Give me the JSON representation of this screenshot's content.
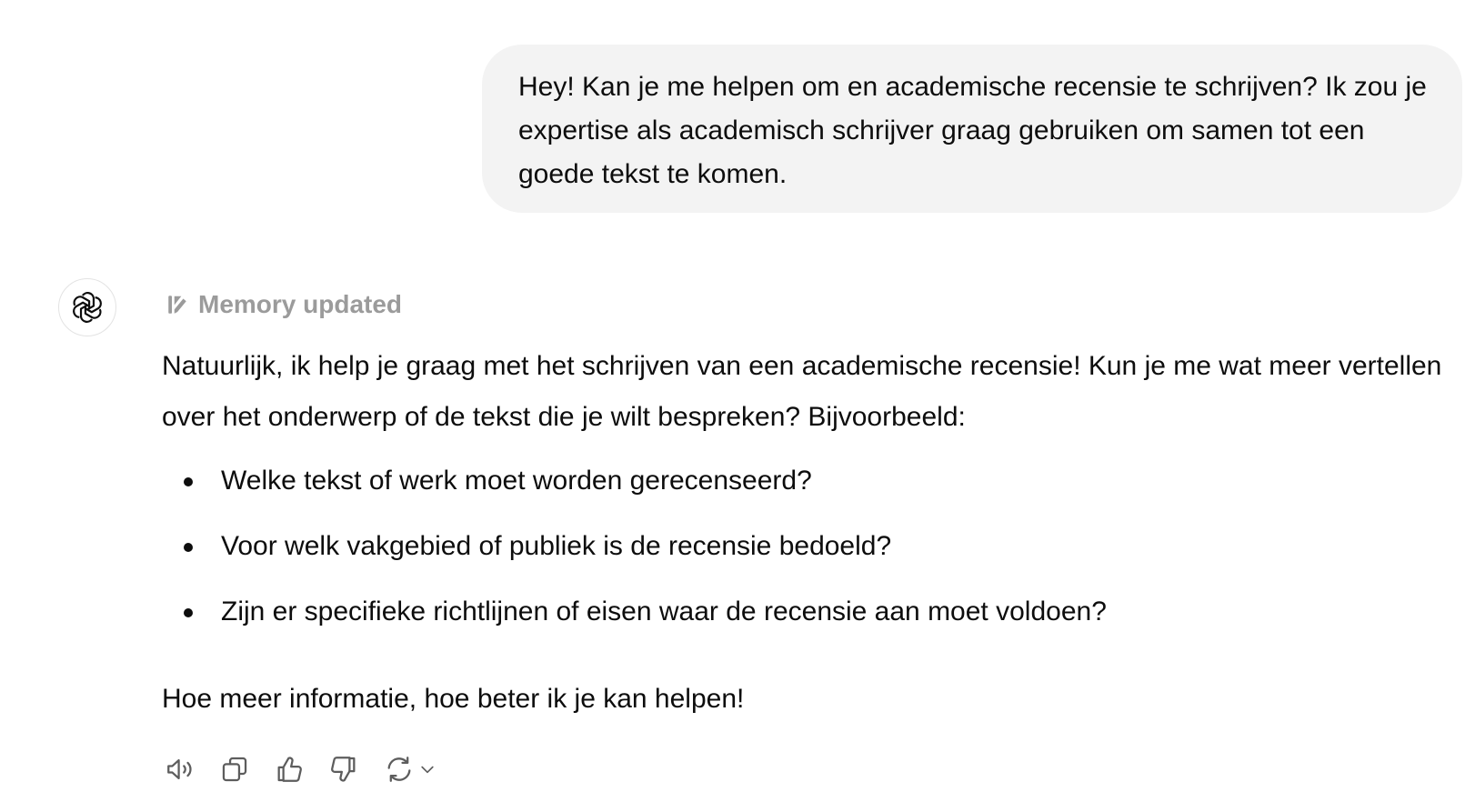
{
  "user_message": {
    "text": "Hey! Kan je me helpen om en academische recensie te schrijven? Ik zou je expertise als academisch schrijver graag gebruiken om samen tot een goede tekst te komen."
  },
  "assistant": {
    "avatar_icon": "openai-logo-icon",
    "memory_label": "Memory updated",
    "memory_icon": "memory-pencil-icon",
    "intro": "Natuurlijk, ik help je graag met het schrijven van een academische recensie! Kun je me wat meer vertellen over het onderwerp of de tekst die je wilt bespreken? Bijvoorbeeld:",
    "bullets": [
      "Welke tekst of werk moet worden gerecenseerd?",
      "Voor welk vakgebied of publiek is de recensie bedoeld?",
      "Zijn er specifieke richtlijnen of eisen waar de recensie aan moet voldoen?"
    ],
    "closing": "Hoe meer informatie, hoe beter ik je kan helpen!"
  },
  "actions": [
    {
      "icon": "speaker-icon"
    },
    {
      "icon": "copy-icon"
    },
    {
      "icon": "thumbs-up-icon"
    },
    {
      "icon": "thumbs-down-icon"
    },
    {
      "icon": "regenerate-icon"
    }
  ],
  "colors": {
    "bubble_bg": "#f3f3f3",
    "text": "#0d0d0d",
    "muted": "#9b9b9b",
    "icon": "#5d5d5d"
  }
}
